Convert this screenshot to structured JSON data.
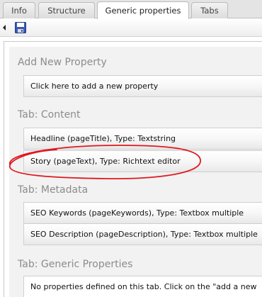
{
  "tabs": [
    {
      "label": "Info"
    },
    {
      "label": "Structure"
    },
    {
      "label": "Generic properties",
      "active": true
    },
    {
      "label": "Tabs"
    }
  ],
  "toolbar": {
    "back_icon": "triangle-left-icon",
    "save_icon": "floppy-disk-icon"
  },
  "add_property": {
    "title": "Add New Property",
    "button_label": "Click here to add a new property"
  },
  "sections": [
    {
      "title": "Tab: Content",
      "properties": [
        "Headline (pageTitle), Type: Textstring",
        "Story (pageText), Type: Richtext editor"
      ]
    },
    {
      "title": "Tab: Metadata",
      "properties": [
        "SEO Keywords (pageKeywords), Type: Textbox multiple",
        "SEO Description (pageDescription), Type: Textbox multiple"
      ]
    },
    {
      "title": "Tab: Generic Properties",
      "note": "No properties defined on this tab. Click on the \"add a new"
    }
  ],
  "colors": {
    "highlight_circle": "#e0191f",
    "section_title": "#8c8c8c",
    "panel_bg": "#f2f2f2"
  }
}
